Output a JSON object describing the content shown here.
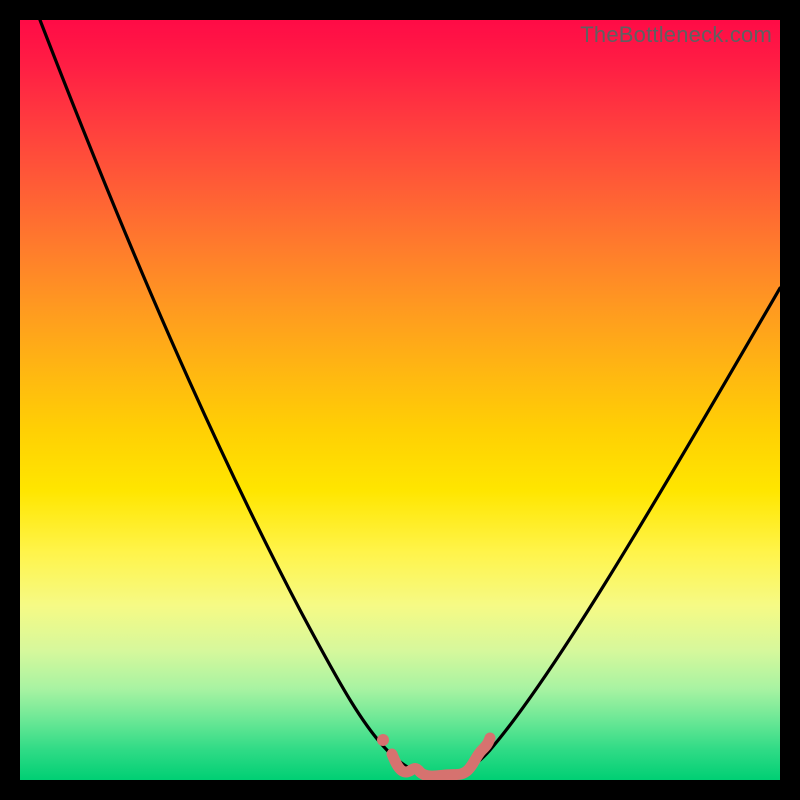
{
  "attribution": "TheBottleneck.com",
  "colors": {
    "frame_bg": "#000000",
    "curve_stroke": "#000000",
    "squiggle_stroke": "#d6726f",
    "squiggle_dot": "#d6726f",
    "gradient_stops": [
      "#ff0b46",
      "#ff3e3e",
      "#ff7c2c",
      "#ffb612",
      "#ffe600",
      "#f6fa85",
      "#a8f3a2",
      "#30db86",
      "#00cf74"
    ]
  },
  "chart_data": {
    "type": "line",
    "title": "",
    "xlabel": "",
    "ylabel": "",
    "xlim": [
      0,
      100
    ],
    "ylim": [
      0,
      100
    ],
    "series": [
      {
        "name": "bottleneck-curve",
        "x": [
          0,
          5,
          10,
          15,
          20,
          25,
          30,
          35,
          40,
          45,
          50,
          52,
          55,
          58,
          60,
          65,
          70,
          75,
          80,
          85,
          90,
          95,
          100
        ],
        "y": [
          100,
          89,
          78,
          67,
          56,
          45,
          34,
          23,
          13,
          5,
          1,
          0,
          0,
          0,
          1,
          5,
          11,
          18,
          26,
          35,
          45,
          55,
          66
        ]
      }
    ],
    "annotations": [
      {
        "name": "optimal-region-squiggle",
        "x_range": [
          48,
          60
        ],
        "y": 0
      },
      {
        "name": "squiggle-dot",
        "x": 47.5,
        "y": 1.5
      }
    ]
  }
}
